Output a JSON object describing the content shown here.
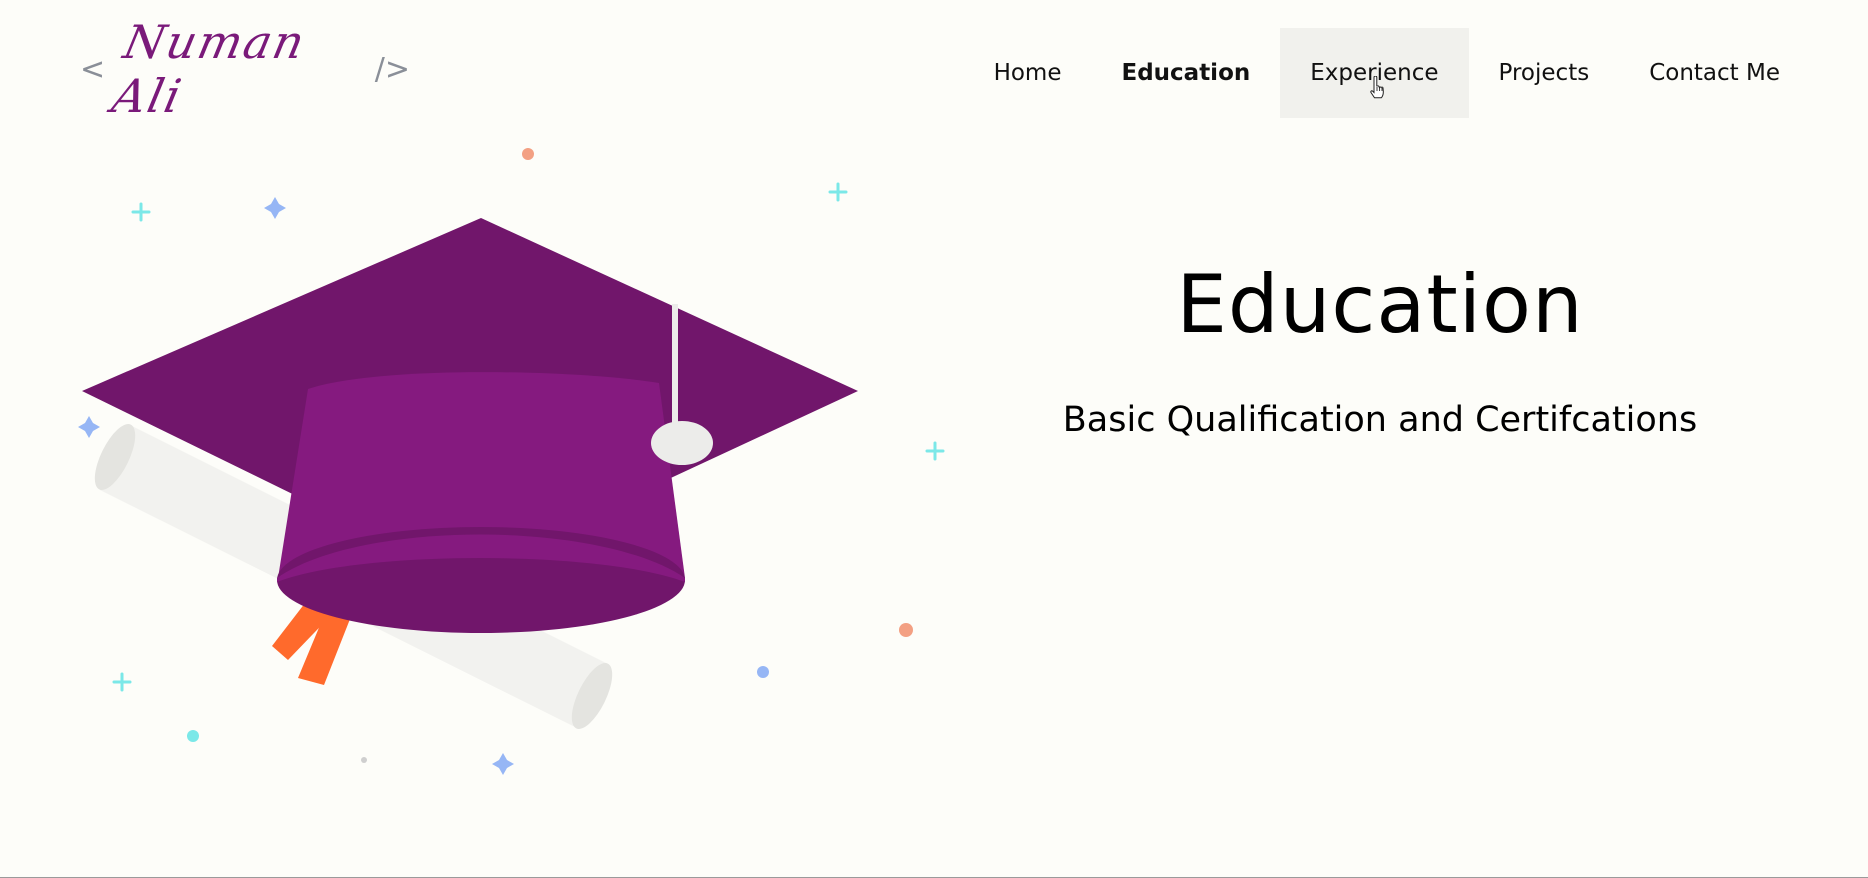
{
  "header": {
    "logo": {
      "open_bracket": "<",
      "name": "Numan Ali",
      "close_bracket": "/>"
    },
    "nav": {
      "home": "Home",
      "education": "Education",
      "experience": "Experience",
      "projects": "Projects",
      "contact": "Contact Me"
    }
  },
  "hero": {
    "title": "Education",
    "subtitle": "Basic Qualification and Certifcations"
  },
  "illustration": {
    "name": "graduation-cap-illustration",
    "colors": {
      "cap_top": "#71166b",
      "cap_body": "#851a7f",
      "tassel": "#ececea",
      "ribbon": "#ff6a2c",
      "diploma": "#f2f2ef",
      "confetti_cyan": "#7be8e8",
      "confetti_blue": "#96b6f5",
      "confetti_orange": "#f3a083"
    }
  }
}
